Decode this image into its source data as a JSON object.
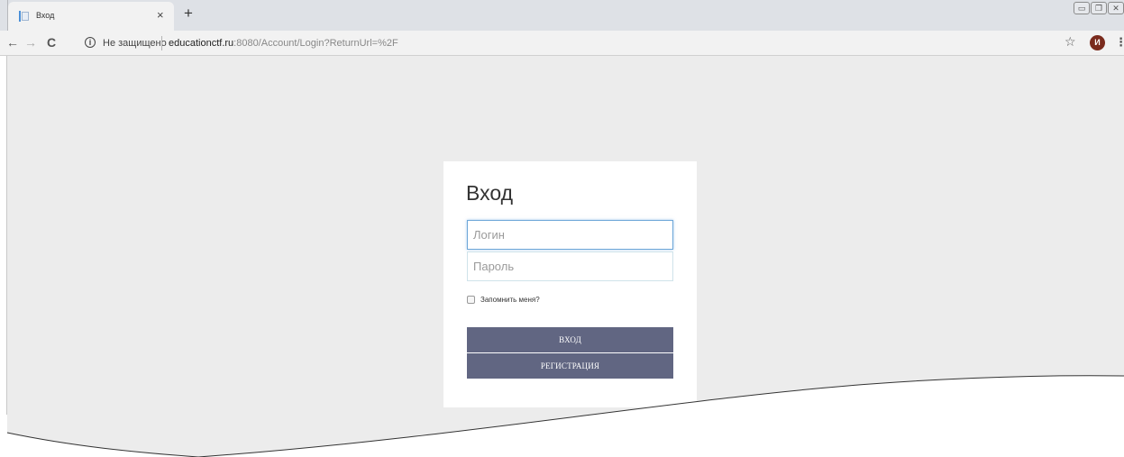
{
  "browser": {
    "tab_title": "Вход",
    "tab_close": "×",
    "new_tab": "+",
    "security_label": "Не защищено",
    "url_host": "educationctf.ru",
    "url_rest": ":8080/Account/Login?ReturnUrl=%2F",
    "avatar_letter": "И",
    "icons": {
      "back": "back-arrow-icon",
      "forward": "forward-arrow-icon",
      "reload": "reload-icon",
      "info": "info-icon",
      "star": "star-icon",
      "menu": "menu-icon"
    }
  },
  "login": {
    "title": "Вход",
    "login_placeholder": "Логин",
    "password_placeholder": "Пароль",
    "remember_label": "Запомнить меня?",
    "login_button": "ВХОД",
    "register_button": "РЕГИСТРАЦИЯ"
  },
  "colors": {
    "page_background": "#ececec",
    "button": "#616682",
    "avatar": "#7a2b1d"
  }
}
